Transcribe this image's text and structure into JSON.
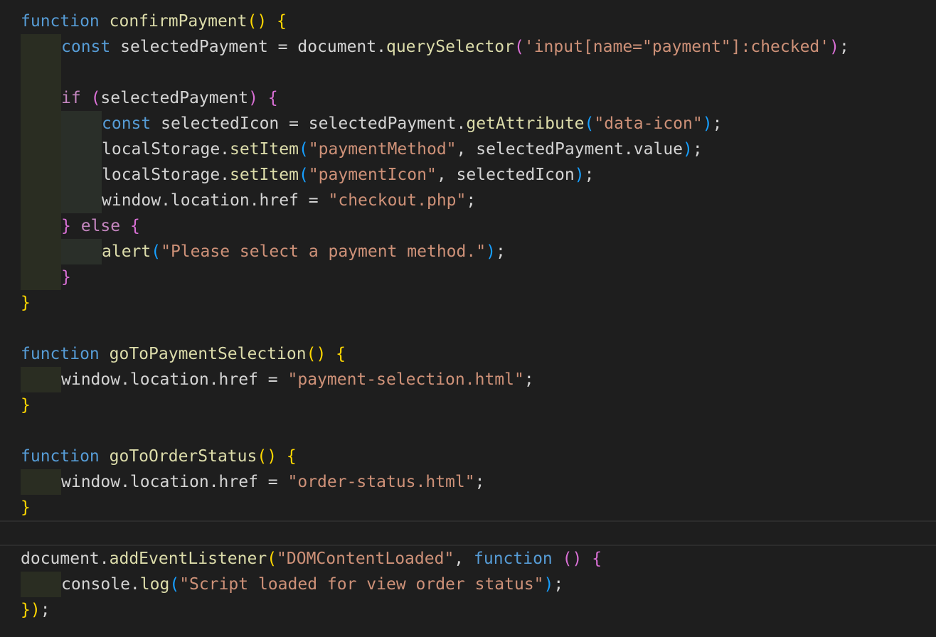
{
  "editor": {
    "language": "javascript",
    "colors": {
      "background": "#1e1e1e",
      "keyword": "#569cd6",
      "control": "#c586c0",
      "function": "#dcdcaa",
      "string": "#ce9178",
      "text": "#d4d4d4",
      "bracket1": "#ffd700",
      "bracket2": "#da70d6",
      "bracket3": "#179fff",
      "indent_guide": "#2a2d22"
    },
    "lines": [
      {
        "indent": 0,
        "tokens": [
          [
            "kw",
            "function"
          ],
          [
            "plain",
            " "
          ],
          [
            "fn",
            "confirmPayment"
          ],
          [
            "p1",
            "()"
          ],
          [
            "plain",
            " "
          ],
          [
            "p1",
            "{"
          ]
        ]
      },
      {
        "indent": 1,
        "tokens": [
          [
            "kw",
            "const"
          ],
          [
            "plain",
            " selectedPayment = document."
          ],
          [
            "fn",
            "querySelector"
          ],
          [
            "p2",
            "("
          ],
          [
            "str",
            "'input[name=\"payment\"]:checked'"
          ],
          [
            "p2",
            ")"
          ],
          [
            "punc",
            ";"
          ]
        ]
      },
      {
        "indent": 1,
        "empty": true,
        "tokens": []
      },
      {
        "indent": 1,
        "tokens": [
          [
            "ctrl",
            "if"
          ],
          [
            "plain",
            " "
          ],
          [
            "p2",
            "("
          ],
          [
            "plain",
            "selectedPayment"
          ],
          [
            "p2",
            ")"
          ],
          [
            "plain",
            " "
          ],
          [
            "p2",
            "{"
          ]
        ]
      },
      {
        "indent": 2,
        "tokens": [
          [
            "kw",
            "const"
          ],
          [
            "plain",
            " selectedIcon = selectedPayment."
          ],
          [
            "fn",
            "getAttribute"
          ],
          [
            "p3",
            "("
          ],
          [
            "str",
            "\"data-icon\""
          ],
          [
            "p3",
            ")"
          ],
          [
            "punc",
            ";"
          ]
        ]
      },
      {
        "indent": 2,
        "tokens": [
          [
            "plain",
            "localStorage."
          ],
          [
            "fn",
            "setItem"
          ],
          [
            "p3",
            "("
          ],
          [
            "str",
            "\"paymentMethod\""
          ],
          [
            "plain",
            ", selectedPayment.value"
          ],
          [
            "p3",
            ")"
          ],
          [
            "punc",
            ";"
          ]
        ]
      },
      {
        "indent": 2,
        "tokens": [
          [
            "plain",
            "localStorage."
          ],
          [
            "fn",
            "setItem"
          ],
          [
            "p3",
            "("
          ],
          [
            "str",
            "\"paymentIcon\""
          ],
          [
            "plain",
            ", selectedIcon"
          ],
          [
            "p3",
            ")"
          ],
          [
            "punc",
            ";"
          ]
        ]
      },
      {
        "indent": 2,
        "tokens": [
          [
            "plain",
            "window.location.href = "
          ],
          [
            "str",
            "\"checkout.php\""
          ],
          [
            "punc",
            ";"
          ]
        ]
      },
      {
        "indent": 1,
        "tokens": [
          [
            "p2",
            "}"
          ],
          [
            "plain",
            " "
          ],
          [
            "ctrl",
            "else"
          ],
          [
            "plain",
            " "
          ],
          [
            "p2",
            "{"
          ]
        ]
      },
      {
        "indent": 2,
        "tokens": [
          [
            "fn",
            "alert"
          ],
          [
            "p3",
            "("
          ],
          [
            "str",
            "\"Please select a payment method.\""
          ],
          [
            "p3",
            ")"
          ],
          [
            "punc",
            ";"
          ]
        ]
      },
      {
        "indent": 1,
        "tokens": [
          [
            "p2",
            "}"
          ]
        ]
      },
      {
        "indent": 0,
        "tokens": [
          [
            "p1",
            "}"
          ]
        ]
      },
      {
        "indent": 0,
        "empty": true,
        "tokens": []
      },
      {
        "indent": 0,
        "tokens": [
          [
            "kw",
            "function"
          ],
          [
            "plain",
            " "
          ],
          [
            "fn",
            "goToPaymentSelection"
          ],
          [
            "p1",
            "()"
          ],
          [
            "plain",
            " "
          ],
          [
            "p1",
            "{"
          ]
        ]
      },
      {
        "indent": 1,
        "tokens": [
          [
            "plain",
            "window.location.href = "
          ],
          [
            "str",
            "\"payment-selection.html\""
          ],
          [
            "punc",
            ";"
          ]
        ]
      },
      {
        "indent": 0,
        "tokens": [
          [
            "p1",
            "}"
          ]
        ]
      },
      {
        "indent": 0,
        "empty": true,
        "tokens": []
      },
      {
        "indent": 0,
        "tokens": [
          [
            "kw",
            "function"
          ],
          [
            "plain",
            " "
          ],
          [
            "fn",
            "goToOrderStatus"
          ],
          [
            "p1",
            "()"
          ],
          [
            "plain",
            " "
          ],
          [
            "p1",
            "{"
          ]
        ]
      },
      {
        "indent": 1,
        "tokens": [
          [
            "plain",
            "window.location.href = "
          ],
          [
            "str",
            "\"order-status.html\""
          ],
          [
            "punc",
            ";"
          ]
        ]
      },
      {
        "indent": 0,
        "tokens": [
          [
            "p1",
            "}"
          ]
        ]
      },
      {
        "indent": 0,
        "empty": true,
        "current": true,
        "tokens": []
      },
      {
        "indent": 0,
        "tokens": [
          [
            "plain",
            "document."
          ],
          [
            "fn",
            "addEventListener"
          ],
          [
            "p1",
            "("
          ],
          [
            "str",
            "\"DOMContentLoaded\""
          ],
          [
            "plain",
            ", "
          ],
          [
            "kw",
            "function"
          ],
          [
            "plain",
            " "
          ],
          [
            "p2",
            "()"
          ],
          [
            "plain",
            " "
          ],
          [
            "p2",
            "{"
          ]
        ]
      },
      {
        "indent": 1,
        "tokens": [
          [
            "plain",
            "console."
          ],
          [
            "fn",
            "log"
          ],
          [
            "p3",
            "("
          ],
          [
            "str",
            "\"Script loaded for view order status\""
          ],
          [
            "p3",
            ")"
          ],
          [
            "punc",
            ";"
          ]
        ]
      },
      {
        "indent": 0,
        "tokens": [
          [
            "p1",
            "}"
          ],
          [
            "p1",
            ")"
          ],
          [
            "punc",
            ";"
          ]
        ]
      }
    ]
  }
}
